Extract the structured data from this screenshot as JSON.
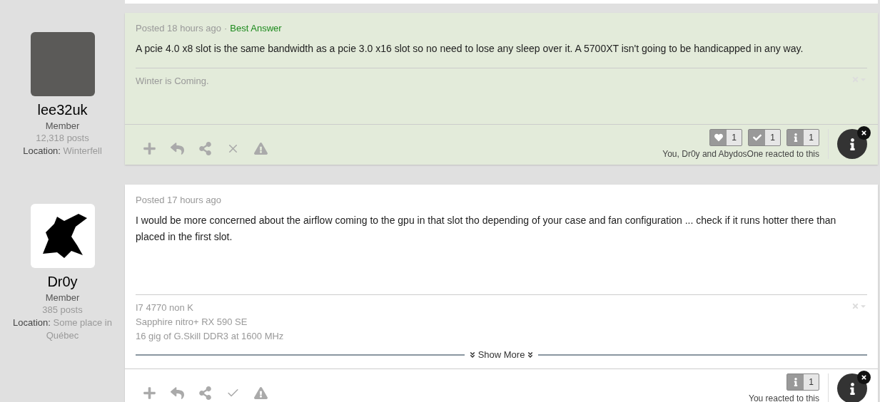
{
  "posts": [
    {
      "author": {
        "name": "lee32uk",
        "rank": "Member",
        "posts": "12,318 posts",
        "location_label": "Location:",
        "location": "Winterfell",
        "avatar": {
          "kind": "photo"
        }
      },
      "posted": "Posted 18 hours ago",
      "separator": "·",
      "best_answer": "Best Answer",
      "highlighted": true,
      "body": [
        "A pcie 4.0 x8 slot is the same bandwidth as a pcie 3.0 x16 slot so no need to lose any sleep over it. A 5700XT isn't going to be handicapped in any way."
      ],
      "signature": [
        "Winter is Coming."
      ],
      "actions": [
        {
          "kind": "add"
        },
        {
          "kind": "reply"
        },
        {
          "kind": "share"
        },
        {
          "kind": "close"
        },
        {
          "kind": "report"
        }
      ],
      "reactions": [
        {
          "kind": "heart",
          "count": "1"
        },
        {
          "kind": "check",
          "count": "1"
        },
        {
          "kind": "info",
          "count": "1"
        }
      ],
      "reacted": "You, Dr0y and AbydosOne reacted to this"
    },
    {
      "author": {
        "name": "Dr0y",
        "rank": "Member",
        "posts": "385 posts",
        "location_label": "Location:",
        "location": "Some place in Québec",
        "avatar": {
          "kind": "drawing"
        }
      },
      "posted": "Posted 17 hours ago",
      "highlighted": false,
      "body": [
        "I would be more concerned about the airflow coming to the gpu in that slot tho depending of your case and fan configuration ... check if it runs hotter there than placed in the first slot."
      ],
      "signature": [
        "I7 4770 non K",
        "Sapphire nitro+ RX 590 SE",
        "16 gig of G.Skill DDR3 at 1600 MHz"
      ],
      "show_more": "Show More",
      "actions": [
        {
          "kind": "add"
        },
        {
          "kind": "reply"
        },
        {
          "kind": "share"
        },
        {
          "kind": "check"
        },
        {
          "kind": "report"
        }
      ],
      "reactions": [
        {
          "kind": "info",
          "count": "1"
        }
      ],
      "reacted": "You reacted to this"
    }
  ]
}
